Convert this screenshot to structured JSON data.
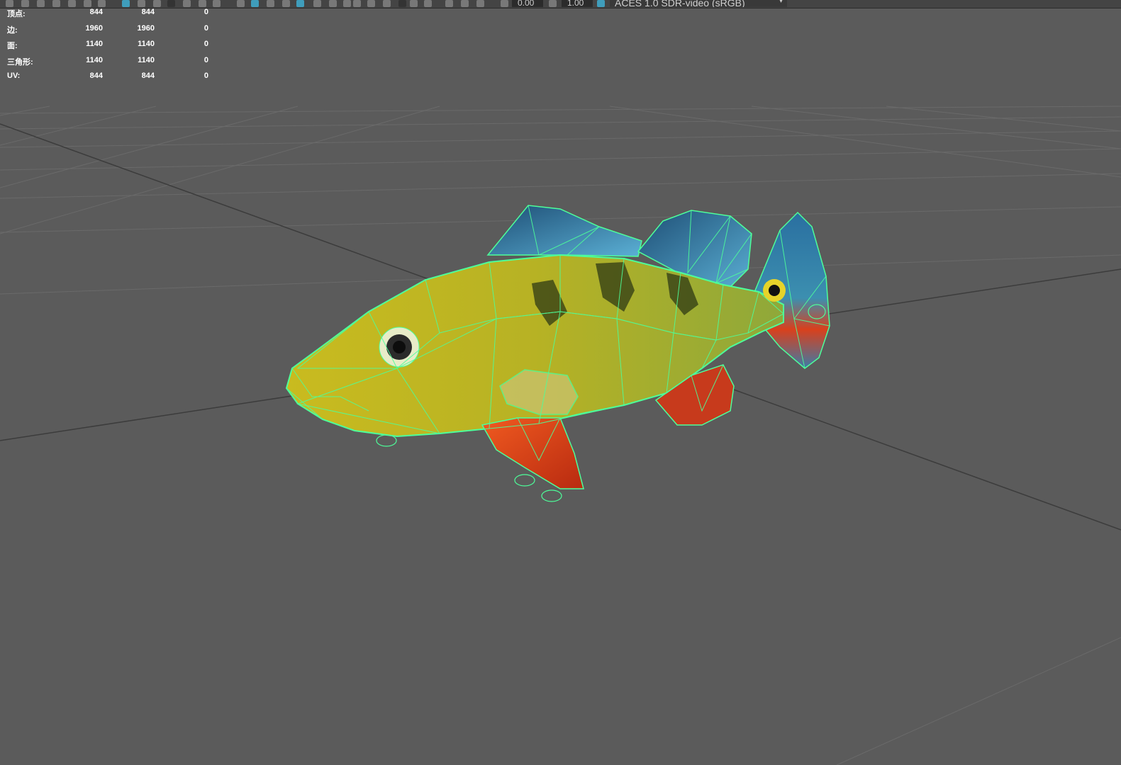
{
  "toolbar": {
    "exposure_value": "0.00",
    "gamma_value": "1.00",
    "color_space": "ACES 1.0 SDR-video (sRGB)"
  },
  "hud": {
    "rows": [
      {
        "label": "顶点:",
        "a": "844",
        "b": "844",
        "c": "0"
      },
      {
        "label": "边:",
        "a": "1960",
        "b": "1960",
        "c": "0"
      },
      {
        "label": "面:",
        "a": "1140",
        "b": "1140",
        "c": "0"
      },
      {
        "label": "三角形:",
        "a": "1140",
        "b": "1140",
        "c": "0"
      },
      {
        "label": "UV:",
        "a": "844",
        "b": "844",
        "c": "0"
      }
    ]
  },
  "colors": {
    "viewport_bg": "#5b5b5b",
    "grid_line": "#6a6a6a",
    "axis_line": "#3a3a3a",
    "wireframe": "#4dff9a",
    "fish_body": "#b8b21e",
    "fin_blue": "#3a7ea8",
    "fin_red": "#e0401a"
  }
}
